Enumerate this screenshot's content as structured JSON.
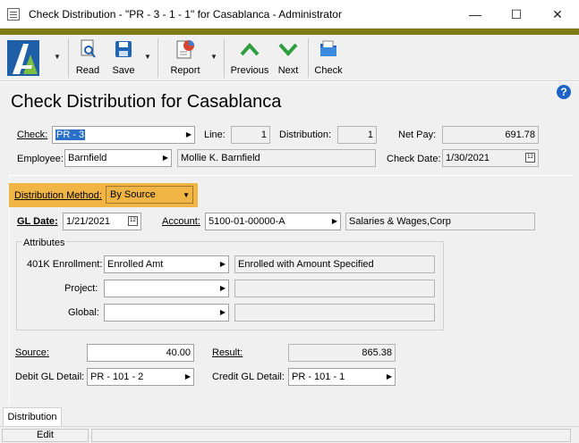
{
  "window": {
    "title": "Check Distribution - \"PR - 3 - 1 - 1\" for Casablanca - Administrator",
    "minimize": "—",
    "maximize": "☐",
    "close": "✕"
  },
  "toolbar": {
    "read": "Read",
    "save": "Save",
    "report": "Report",
    "previous": "Previous",
    "next": "Next",
    "check": "Check"
  },
  "page_title": "Check Distribution for Casablanca",
  "header": {
    "check_label": "Check:",
    "check_value": "PR - 3",
    "line_label": "Line:",
    "line_value": "1",
    "distribution_label": "Distribution:",
    "distribution_value": "1",
    "net_pay_label": "Net Pay:",
    "net_pay_value": "691.78",
    "employee_label": "Employee:",
    "employee_value": "Barnfield",
    "employee_name": "Mollie K. Barnfield",
    "check_date_label": "Check Date:",
    "check_date_value": "1/30/2021"
  },
  "distribution": {
    "method_label": "Distribution Method:",
    "method_value": "By Source",
    "gl_date_label": "GL Date:",
    "gl_date_value": "1/21/2021",
    "account_label": "Account:",
    "account_value": "5100-01-00000-A",
    "account_desc": "Salaries & Wages,Corp"
  },
  "attributes": {
    "legend": "Attributes",
    "rows": [
      {
        "label": "401K Enrollment:",
        "value": "Enrolled Amt",
        "desc": "Enrolled with Amount Specified"
      },
      {
        "label": "Project:",
        "value": "",
        "desc": ""
      },
      {
        "label": "Global:",
        "value": "",
        "desc": ""
      }
    ]
  },
  "amounts": {
    "source_label": "Source:",
    "source_value": "40.00",
    "result_label": "Result:",
    "result_value": "865.38",
    "debit_label": "Debit GL Detail:",
    "debit_value": "PR - 101 - 2",
    "credit_label": "Credit GL Detail:",
    "credit_value": "PR - 101 - 1"
  },
  "tabs": [
    "Distribution"
  ],
  "status": {
    "mode": "Edit"
  },
  "colors": {
    "olive_bar": "#7e7b11",
    "highlight": "#f0b545",
    "arrow_green": "#2f9e3f"
  }
}
